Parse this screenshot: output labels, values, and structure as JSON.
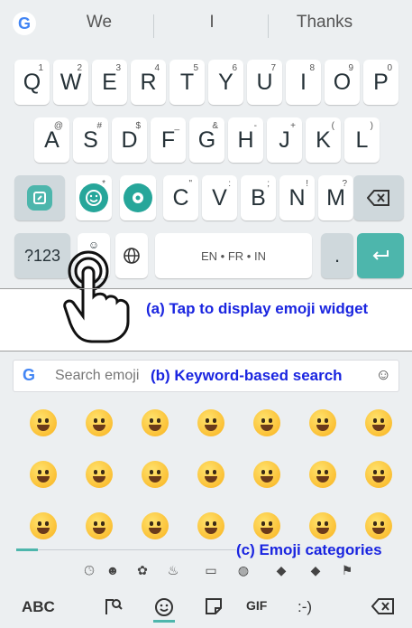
{
  "suggestions": [
    "We",
    "I",
    "Thanks"
  ],
  "row1": [
    {
      "k": "Q",
      "s": "1"
    },
    {
      "k": "W",
      "s": "2"
    },
    {
      "k": "E",
      "s": "3"
    },
    {
      "k": "R",
      "s": "4"
    },
    {
      "k": "T",
      "s": "5"
    },
    {
      "k": "Y",
      "s": "6"
    },
    {
      "k": "U",
      "s": "7"
    },
    {
      "k": "I",
      "s": "8"
    },
    {
      "k": "O",
      "s": "9"
    },
    {
      "k": "P",
      "s": "0"
    }
  ],
  "row2": [
    {
      "k": "A",
      "s": "@"
    },
    {
      "k": "S",
      "s": "#"
    },
    {
      "k": "D",
      "s": "$"
    },
    {
      "k": "F",
      "s": "_"
    },
    {
      "k": "G",
      "s": "&"
    },
    {
      "k": "H",
      "s": "-"
    },
    {
      "k": "J",
      "s": "+"
    },
    {
      "k": "K",
      "s": "("
    },
    {
      "k": "L",
      "s": ")"
    }
  ],
  "row3": [
    {
      "k": "C",
      "s": "\""
    },
    {
      "k": "V",
      "s": ":"
    },
    {
      "k": "B",
      "s": ";"
    },
    {
      "k": "N",
      "s": "!"
    },
    {
      "k": "M",
      "s": "?"
    }
  ],
  "bottom_row": {
    "symbols_label": "?123",
    "language_label": "EN • FR • IN",
    "period_label": "."
  },
  "caption_a": "(a) Tap to display emoji widget",
  "search": {
    "placeholder": "Search emoji"
  },
  "caption_b": "(b) Keyword-based search",
  "caption_c": "(c) Emoji categories",
  "emoji_grid_rows": 3,
  "emoji_grid_cols": 7,
  "emoji_bottom": {
    "abc": "ABC",
    "gif": "GIF",
    "emoticon": ":-)"
  },
  "colors": {
    "accent": "#4db6ac",
    "caption": "#1a25e0",
    "keyboard_bg": "#eceff1"
  }
}
